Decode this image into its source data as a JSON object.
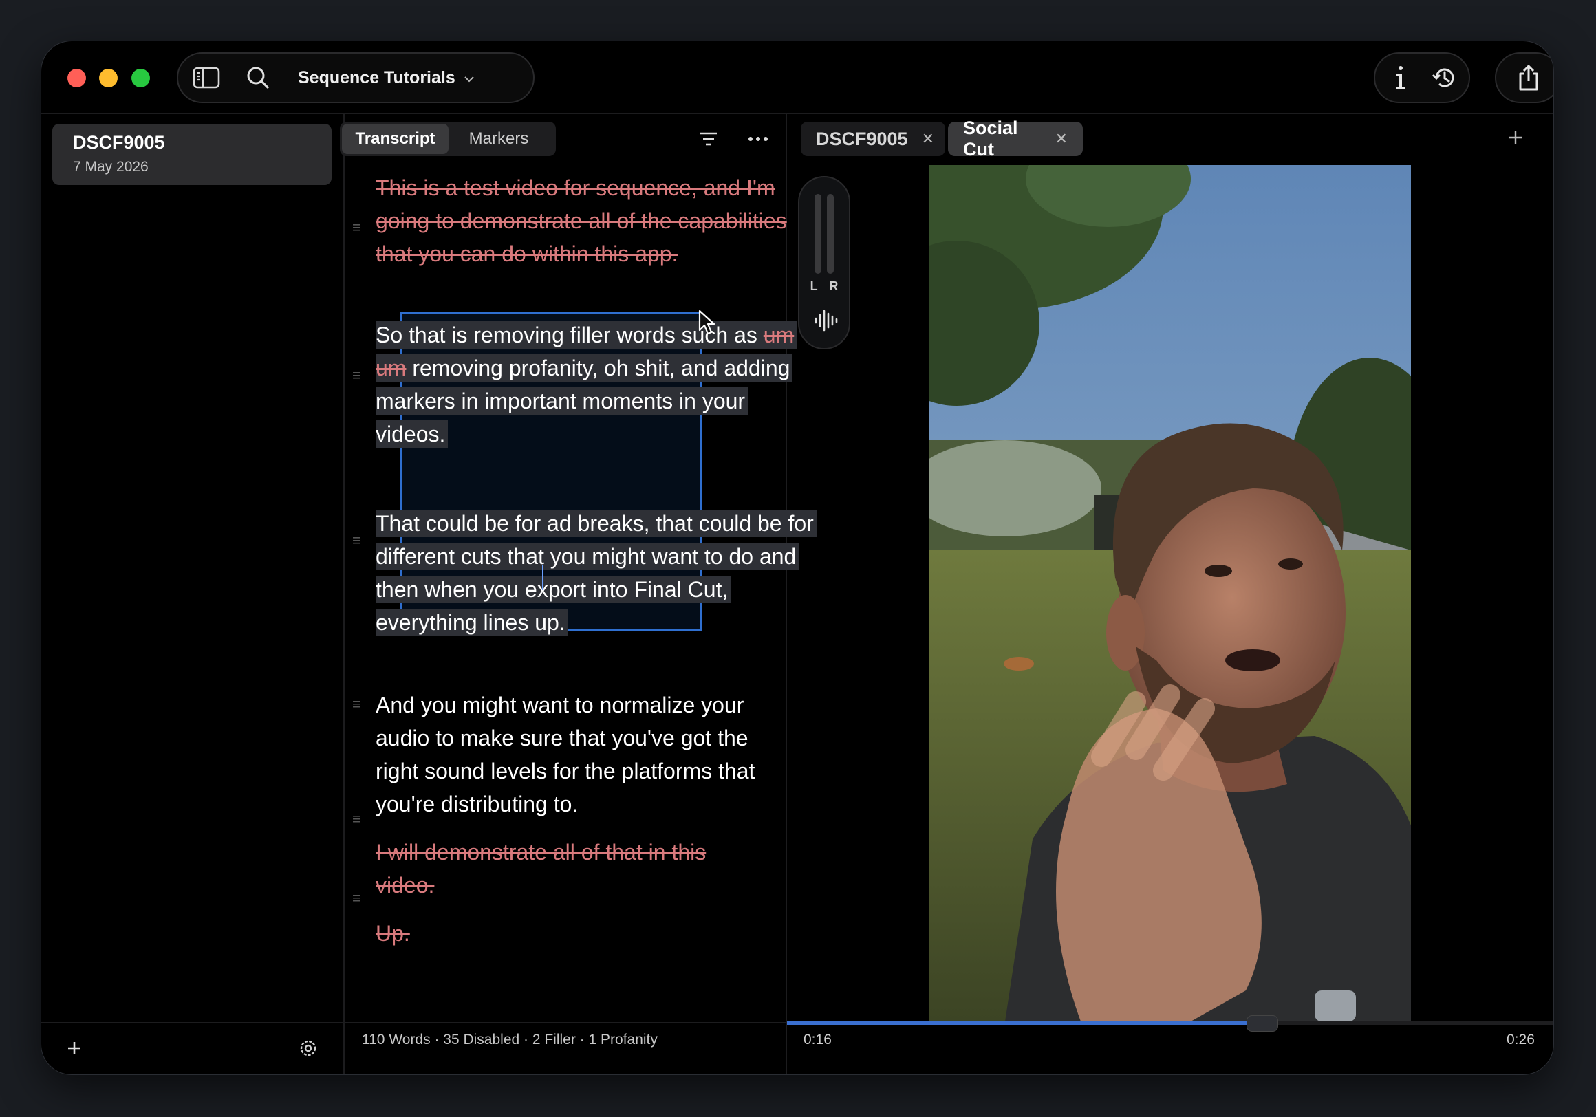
{
  "toolbar": {
    "project_name": "Sequence Tutorials"
  },
  "sidebar": {
    "items": [
      {
        "title": "DSCF9005",
        "date": "7 May 2026"
      }
    ]
  },
  "transcript_panel": {
    "tabs": [
      {
        "label": "Transcript",
        "active": true
      },
      {
        "label": "Markers",
        "active": false
      }
    ],
    "paragraphs": [
      {
        "text": "This is a test video for sequence, and I'm going to demonstrate all of the capabilities that you can do within this app.",
        "disabled": true
      },
      {
        "text_1": "So that is removing filler words such as",
        "filler": "um um",
        "text_2": "removing profanity, oh shit, and adding markers in important moments in your videos.",
        "disabled": false,
        "selected": true
      },
      {
        "text": "That could be for ad breaks, that could be for different cuts that you might want to do and then when you export into Final Cut, everything lines up.",
        "disabled": false,
        "selected": true
      },
      {
        "text": "And you might want to normalize your audio to make sure that you've got the right sound levels for the platforms that you're distributing to.",
        "disabled": false
      },
      {
        "text": "I will demonstrate all of that in this video.",
        "disabled": true
      },
      {
        "text": "Up.",
        "disabled": true
      }
    ],
    "stats": "110 Words · 35 Disabled · 2 Filler · 1 Profanity"
  },
  "preview": {
    "tabs": [
      {
        "label": "DSCF9005",
        "active": false
      },
      {
        "label": "Social Cut",
        "active": true
      }
    ],
    "meter_label": "L R",
    "current_time": "0:16",
    "total_time": "0:26",
    "progress": 0.6153
  },
  "colors": {
    "accent": "#3a6fd0",
    "disabled_text": "#d97a7d",
    "selection_border": "#2f6fd0"
  },
  "icons": [
    "sidebar-toggle-icon",
    "search-icon",
    "chevron-down-icon",
    "info-icon",
    "history-icon",
    "share-icon",
    "filter-icon",
    "more-icon",
    "close-icon",
    "plus-icon",
    "waveform-icon",
    "settings-icon"
  ]
}
